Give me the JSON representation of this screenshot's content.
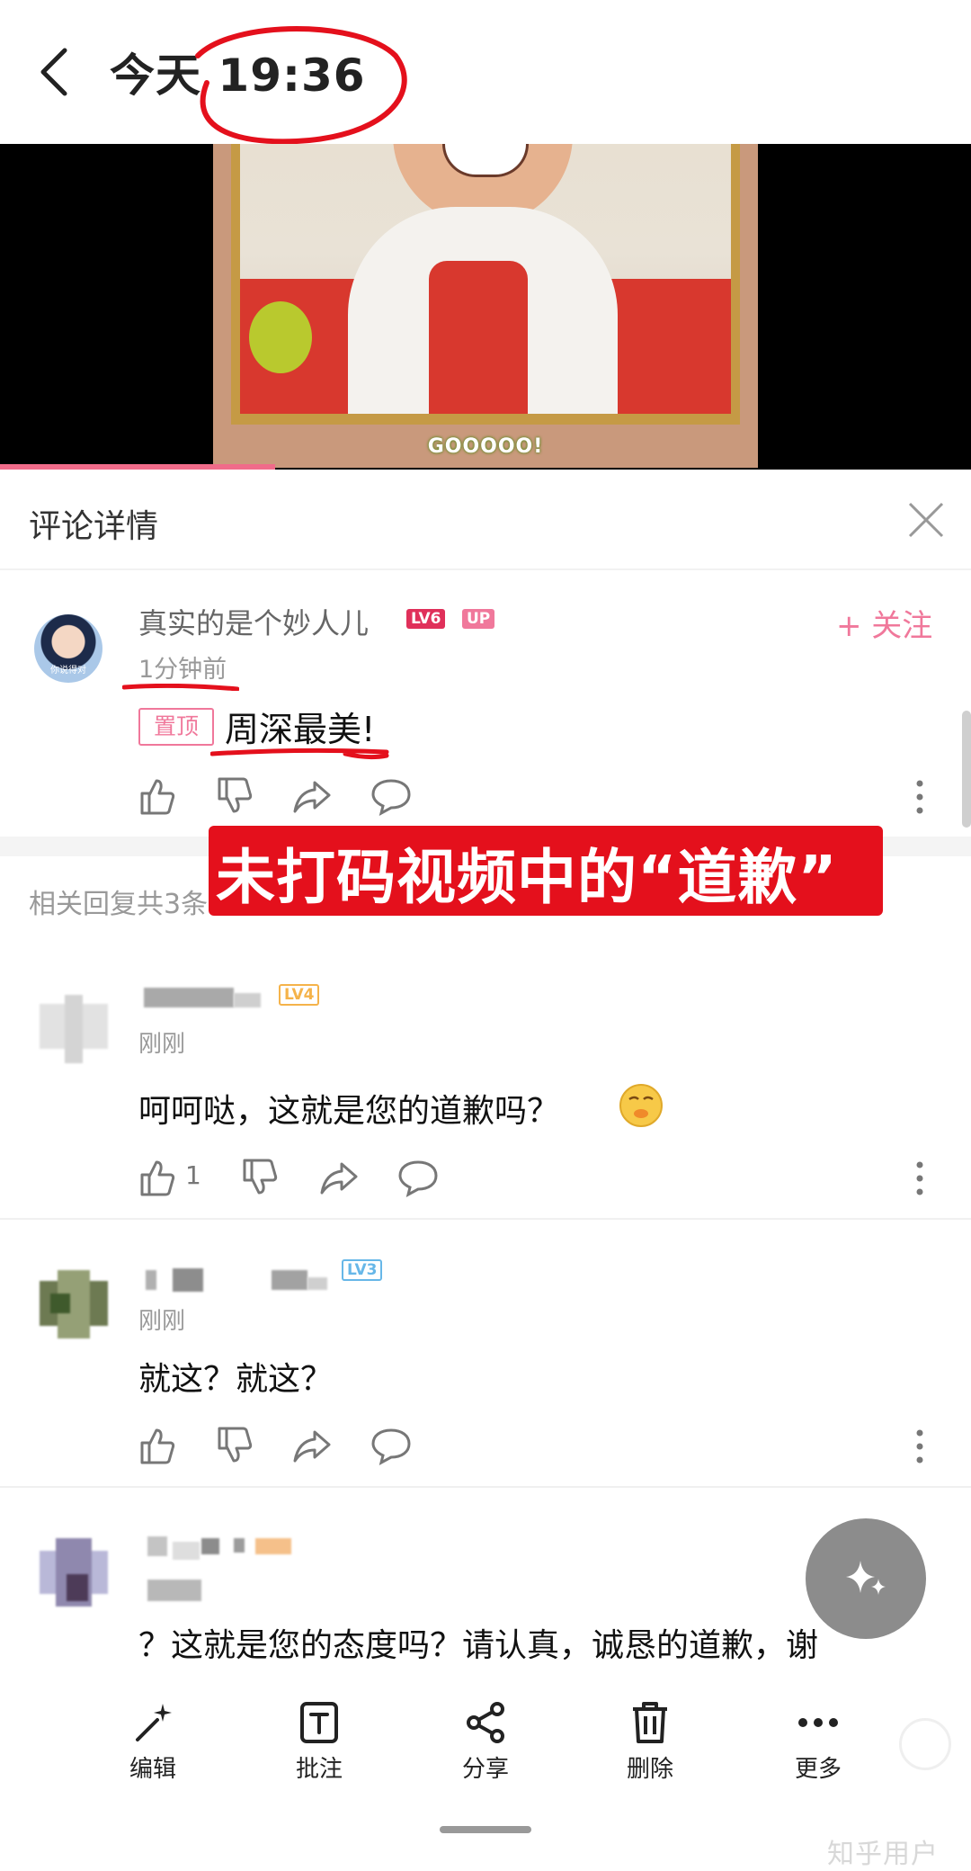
{
  "header": {
    "title": "今天 19:36"
  },
  "video": {
    "caption": "GOOOOO!"
  },
  "panel": {
    "title": "评论详情"
  },
  "main_comment": {
    "username": "真实的是个妙人儿",
    "level": "LV6",
    "up_badge": "UP",
    "follow_label": "+ 关注",
    "time": "1分钟前",
    "pin_label": "置顶",
    "text": "周深最美!",
    "avatar_caption": "你说得对"
  },
  "overlay": {
    "text": "未打码视频中的“道歉”"
  },
  "replies": {
    "count_label": "相关回复共3条",
    "items": [
      {
        "level": "LV4",
        "level_color": "#f5b34a",
        "time": "刚刚",
        "text": "呵呵哒，这就是您的道歉吗？",
        "likes": "1"
      },
      {
        "level": "LV3",
        "level_color": "#67b7e8",
        "time": "刚刚",
        "text": "就这？就这？",
        "likes": ""
      },
      {
        "level": "",
        "level_color": "#f5c08a",
        "time": "",
        "text": "？这就是您的态度吗？请认真，诚恳的道歉，谢",
        "likes": ""
      }
    ]
  },
  "toolbar": {
    "items": [
      {
        "label": "编辑",
        "icon": "magic-wand-icon"
      },
      {
        "label": "批注",
        "icon": "text-annotation-icon"
      },
      {
        "label": "分享",
        "icon": "share-icon"
      },
      {
        "label": "删除",
        "icon": "trash-icon"
      },
      {
        "label": "更多",
        "icon": "more-dots-icon"
      }
    ]
  },
  "watermark": "知乎用户",
  "colors": {
    "accent_pink": "#f0789b",
    "annotation_red": "#e4101c"
  }
}
